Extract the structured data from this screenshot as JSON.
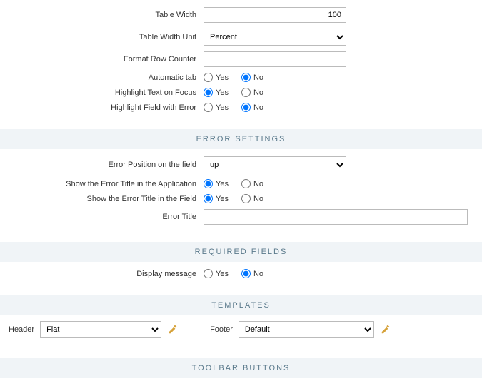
{
  "top": {
    "table_width": {
      "label": "Table Width",
      "value": "100"
    },
    "table_width_unit": {
      "label": "Table Width Unit",
      "value": "Percent"
    },
    "format_row_counter": {
      "label": "Format Row Counter",
      "value": ""
    },
    "automatic_tab": {
      "label": "Automatic tab",
      "yes": "Yes",
      "no": "No",
      "selected": "no"
    },
    "highlight_text_on_focus": {
      "label": "Highlight Text on Focus",
      "yes": "Yes",
      "no": "No",
      "selected": "yes"
    },
    "highlight_field_with_error": {
      "label": "Highlight Field with Error",
      "yes": "Yes",
      "no": "No",
      "selected": "no"
    }
  },
  "error_settings": {
    "header": "Error Settings",
    "error_position": {
      "label": "Error Position on the field",
      "value": "up"
    },
    "show_title_app": {
      "label": "Show the Error Title in the Application",
      "yes": "Yes",
      "no": "No",
      "selected": "yes"
    },
    "show_title_field": {
      "label": "Show the Error Title in the Field",
      "yes": "Yes",
      "no": "No",
      "selected": "yes"
    },
    "error_title": {
      "label": "Error Title",
      "value": ""
    }
  },
  "required_fields": {
    "header": "Required Fields",
    "display_message": {
      "label": "Display message",
      "yes": "Yes",
      "no": "No",
      "selected": "no"
    }
  },
  "templates": {
    "header": "Templates",
    "header_tpl": {
      "label": "Header",
      "value": "Flat"
    },
    "footer_tpl": {
      "label": "Footer",
      "value": "Default"
    }
  },
  "toolbar": {
    "header": "Toolbar Buttons"
  }
}
